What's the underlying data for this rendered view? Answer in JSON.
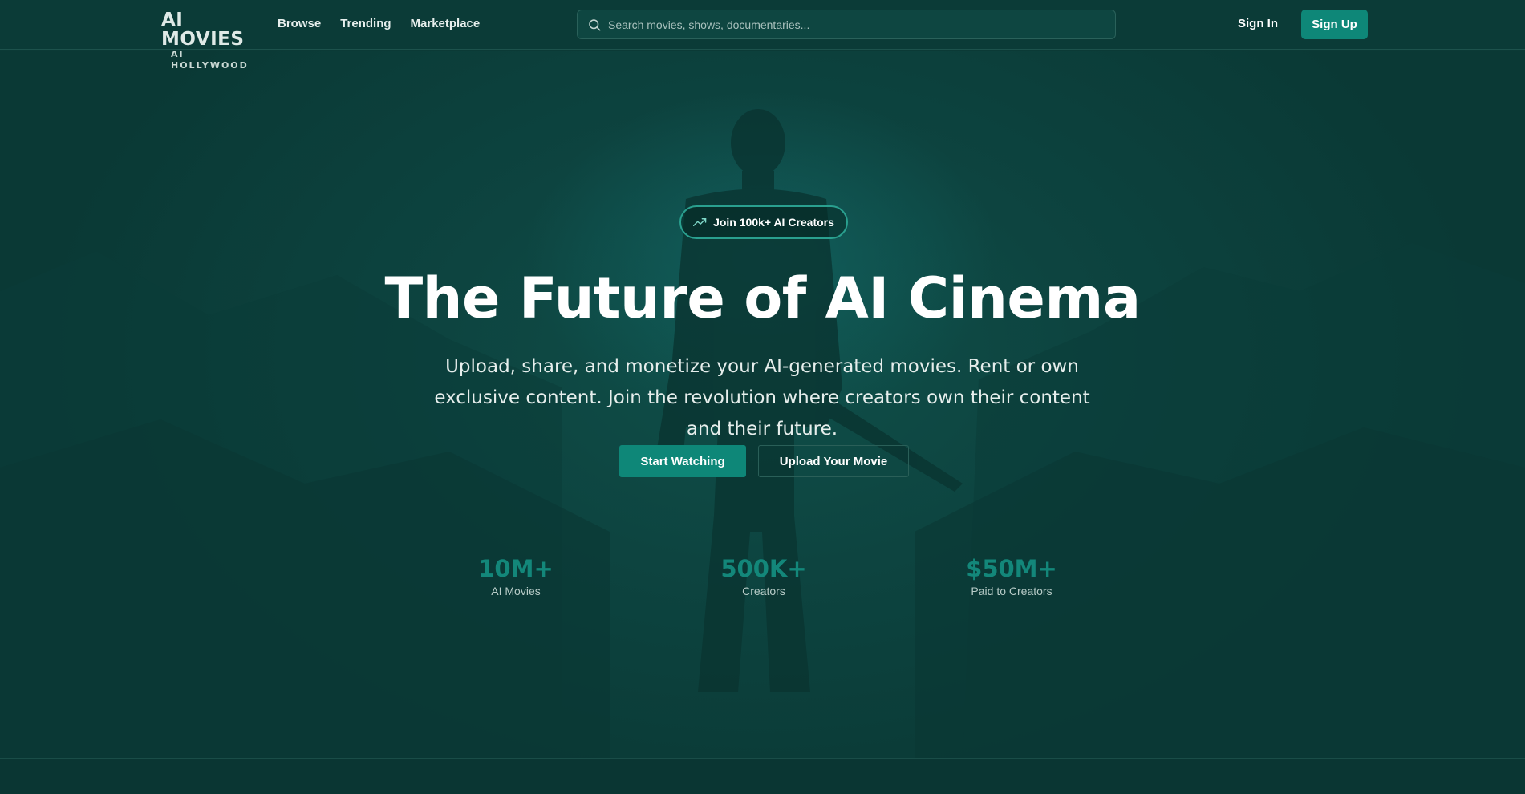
{
  "nav": {
    "logo_main": "AI MOVIES",
    "logo_sub": "AI HOLLYWOOD",
    "links": [
      "Browse",
      "Trending",
      "Marketplace"
    ],
    "search_placeholder": "Search movies, shows, documentaries...",
    "signin_label": "Sign In",
    "signup_label": "Sign Up"
  },
  "hero": {
    "badge": "Join 100k+ AI Creators",
    "title": "The Future of AI Cinema",
    "subtitle": "Upload, share, and monetize your AI-generated movies. Rent or own exclusive content. Join the revolution where creators own their content and their future.",
    "primary_button": "Start Watching",
    "secondary_button": "Upload Your Movie"
  },
  "stats": [
    {
      "value": "10M+",
      "label": "AI Movies"
    },
    {
      "value": "500K+",
      "label": "Creators"
    },
    {
      "value": "$50M+",
      "label": "Paid to Creators"
    }
  ],
  "colors": {
    "background": "#0b3a36",
    "accent": "#0e8778",
    "stat_accent": "#13877a"
  },
  "icons": {
    "search": "search-icon",
    "badge": "trending-up-icon"
  }
}
